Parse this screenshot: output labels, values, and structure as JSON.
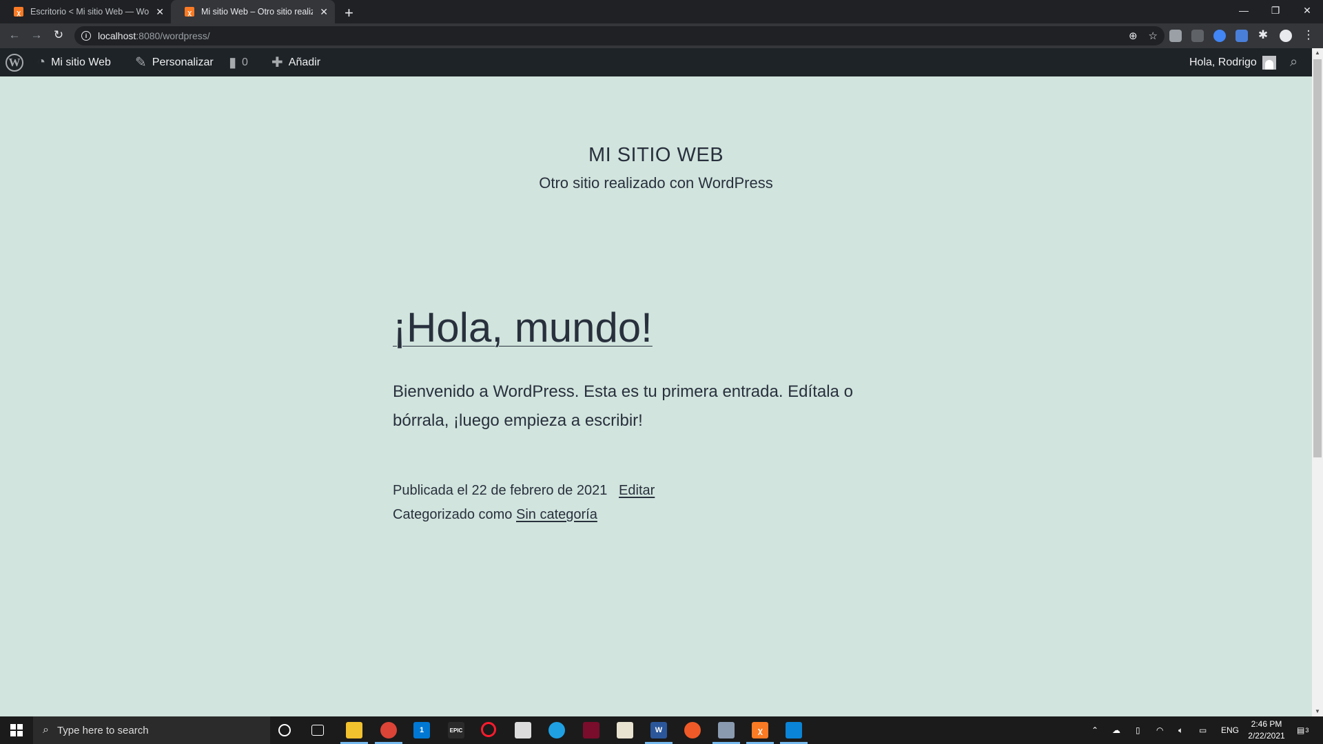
{
  "browser": {
    "tabs": [
      {
        "title": "Escritorio < Mi sitio Web — Wor",
        "active": false
      },
      {
        "title": "Mi sitio Web – Otro sitio realizad",
        "active": true
      }
    ],
    "new_tab": "+",
    "url_host": "localhost",
    "url_path": ":8080/wordpress/"
  },
  "adminbar": {
    "site_name": "Mi sitio Web",
    "customize": "Personalizar",
    "comments_count": "0",
    "add_new": "Añadir",
    "greeting": "Hola, Rodrigo"
  },
  "site": {
    "title": "MI SITIO WEB",
    "description": "Otro sitio realizado con WordPress"
  },
  "post": {
    "title": "¡Hola, mundo!",
    "body": "Bienvenido a WordPress. Esta es tu primera entrada. Edítala o bórrala, ¡luego empieza a escribir!",
    "published": "Publicada el 22 de febrero de 2021",
    "edit": "Editar",
    "categorized_label": "Categorizado como",
    "category": "Sin categoría"
  },
  "taskbar": {
    "search_placeholder": "Type here to search",
    "language": "ENG",
    "time": "2:46 PM",
    "date": "2/22/2021",
    "notification_count": "3",
    "mail_badge": "1"
  },
  "colors": {
    "page_bg": "#d1e4dd",
    "text": "#28303d",
    "adminbar_bg": "#1d2327",
    "xampp_orange": "#fb7a24"
  }
}
